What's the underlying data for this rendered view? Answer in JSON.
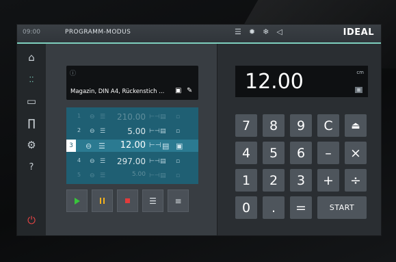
{
  "status": {
    "time": "09:00",
    "mode": "PROGRAMM-MODUS",
    "icons": [
      "stack-icon",
      "light-icon",
      "sparkle-icon",
      "sound-icon"
    ],
    "brand": "IDEAL"
  },
  "sidebar": {
    "items": [
      "home-icon",
      "focus-icon",
      "folder-icon",
      "tools-icon",
      "settings-icon",
      "help-icon",
      "power-icon"
    ],
    "help_label": "?"
  },
  "program": {
    "name": "Magazin, DIN A4, Rückenstich ..."
  },
  "list": [
    {
      "num": "1",
      "value": "210.00",
      "state": "faded"
    },
    {
      "num": "2",
      "value": "5.00",
      "state": "normal"
    },
    {
      "num": "3",
      "value": "12.00",
      "state": "active"
    },
    {
      "num": "4",
      "value": "297.00",
      "state": "normal"
    },
    {
      "num": "5",
      "value": "5.00",
      "state": "faded"
    }
  ],
  "controls": [
    "play-icon",
    "pause-icon",
    "stop-icon",
    "insert-lines-icon",
    "delete-lines-icon"
  ],
  "display": {
    "value": "12.00",
    "unit": "cm"
  },
  "keypad": {
    "rows": [
      [
        "7",
        "8",
        "9",
        "C",
        "⏏"
      ],
      [
        "4",
        "5",
        "6",
        "–",
        "×"
      ],
      [
        "1",
        "2",
        "3",
        "+",
        "÷"
      ],
      [
        "0",
        ".",
        "=",
        "START"
      ]
    ]
  },
  "colors": {
    "accent": "#7fd1bf",
    "list_bg": "#1f5f73",
    "play": "#38c63b",
    "pause": "#f4b21e",
    "stop": "#e23b3b",
    "power": "#e44545"
  }
}
